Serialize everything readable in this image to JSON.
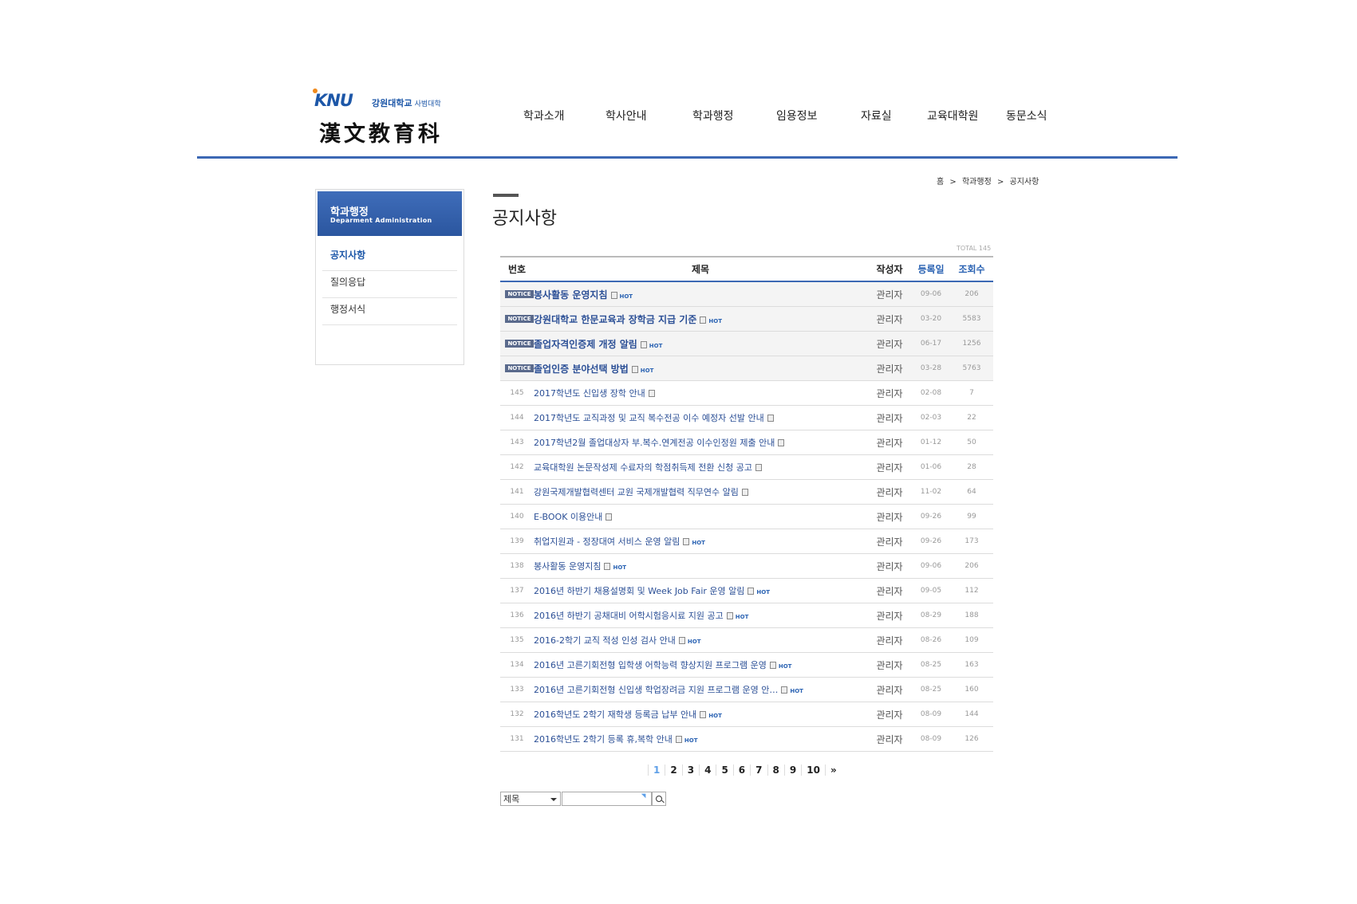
{
  "logo": {
    "brand": "KNU",
    "university": "강원대학교",
    "college": "사범대학",
    "department": "漢文教育科"
  },
  "gnb": [
    "학과소개",
    "학사안내",
    "학과행정",
    "임용정보",
    "자료실",
    "교육대학원",
    "동문소식"
  ],
  "breadcrumb": [
    "홈",
    ">",
    "학과행정",
    ">",
    "공지사항"
  ],
  "side": {
    "title": "학과행정",
    "subtitle": "Deparment Administration",
    "items": [
      "공지사항",
      "질의응답",
      "행정서식"
    ],
    "active_index": 0
  },
  "page_title": "공지사항",
  "board": {
    "total": "TOTAL 145",
    "headers": {
      "num": "번호",
      "subject": "제목",
      "author": "작성자",
      "date": "등록일",
      "views": "조회수"
    },
    "notice_badge": "NOTICE",
    "hot_badge": "HOT",
    "rows": [
      {
        "num": "NOTICE",
        "subject": "봉사활동 운영지침",
        "author": "관리자",
        "date": "09-06",
        "views": "206",
        "notice": true,
        "hot": true
      },
      {
        "num": "NOTICE",
        "subject": "강원대학교 한문교육과 장학금 지급 기준",
        "author": "관리자",
        "date": "03-20",
        "views": "5583",
        "notice": true,
        "hot": true
      },
      {
        "num": "NOTICE",
        "subject": "졸업자격인증제 개정 알림",
        "author": "관리자",
        "date": "06-17",
        "views": "1256",
        "notice": true,
        "hot": true
      },
      {
        "num": "NOTICE",
        "subject": "졸업인증 분야선택 방법",
        "author": "관리자",
        "date": "03-28",
        "views": "5763",
        "notice": true,
        "hot": true
      },
      {
        "num": "145",
        "subject": "2017학년도 신입생 장학 안내",
        "author": "관리자",
        "date": "02-08",
        "views": "7",
        "notice": false,
        "hot": false
      },
      {
        "num": "144",
        "subject": "2017학년도 교직과정 및 교직 복수전공 이수 예정자 선발 안내",
        "author": "관리자",
        "date": "02-03",
        "views": "22",
        "notice": false,
        "hot": false
      },
      {
        "num": "143",
        "subject": "2017학년2월 졸업대상자 부.복수.연계전공 이수인정원 제출 안내",
        "author": "관리자",
        "date": "01-12",
        "views": "50",
        "notice": false,
        "hot": false
      },
      {
        "num": "142",
        "subject": "교육대학원 논문작성제 수료자의 학점취득제 전환 신청 공고",
        "author": "관리자",
        "date": "01-06",
        "views": "28",
        "notice": false,
        "hot": false
      },
      {
        "num": "141",
        "subject": "강원국제개발협력센터 교원 국제개발협력 직무연수 알림",
        "author": "관리자",
        "date": "11-02",
        "views": "64",
        "notice": false,
        "hot": false
      },
      {
        "num": "140",
        "subject": "E-BOOK 이용안내",
        "author": "관리자",
        "date": "09-26",
        "views": "99",
        "notice": false,
        "hot": false
      },
      {
        "num": "139",
        "subject": "취업지원과 - 정장대여 서비스 운영 알림",
        "author": "관리자",
        "date": "09-26",
        "views": "173",
        "notice": false,
        "hot": true
      },
      {
        "num": "138",
        "subject": "봉사활동 운영지침",
        "author": "관리자",
        "date": "09-06",
        "views": "206",
        "notice": false,
        "hot": true
      },
      {
        "num": "137",
        "subject": "2016년 하반기 채용설명회 및 Week Job Fair 운영 알림",
        "author": "관리자",
        "date": "09-05",
        "views": "112",
        "notice": false,
        "hot": true
      },
      {
        "num": "136",
        "subject": "2016년 하반기 공채대비 어학시험응시료 지원 공고",
        "author": "관리자",
        "date": "08-29",
        "views": "188",
        "notice": false,
        "hot": true
      },
      {
        "num": "135",
        "subject": "2016-2학기 교직 적성 인성 검사 안내",
        "author": "관리자",
        "date": "08-26",
        "views": "109",
        "notice": false,
        "hot": true
      },
      {
        "num": "134",
        "subject": "2016년 고른기회전형 입학생 어학능력 향상지원 프로그램 운영",
        "author": "관리자",
        "date": "08-25",
        "views": "163",
        "notice": false,
        "hot": true
      },
      {
        "num": "133",
        "subject": "2016년 고른기회전형 신입생 학업장려금 지원 프로그램 운영 안…",
        "author": "관리자",
        "date": "08-25",
        "views": "160",
        "notice": false,
        "hot": true
      },
      {
        "num": "132",
        "subject": "2016학년도 2학기 재학생 등록금 납부 안내",
        "author": "관리자",
        "date": "08-09",
        "views": "144",
        "notice": false,
        "hot": true
      },
      {
        "num": "131",
        "subject": "2016학년도 2학기 등록 휴,복학 안내",
        "author": "관리자",
        "date": "08-09",
        "views": "126",
        "notice": false,
        "hot": true
      }
    ]
  },
  "pagination": {
    "pages": [
      "1",
      "2",
      "3",
      "4",
      "5",
      "6",
      "7",
      "8",
      "9",
      "10"
    ],
    "current": "1",
    "next": "»"
  },
  "search": {
    "field": "제목",
    "value": "",
    "icon": "search-icon"
  },
  "colors": {
    "accent": "#3c68b4",
    "link": "#2b4f96",
    "current_page": "#5fa0e8"
  }
}
